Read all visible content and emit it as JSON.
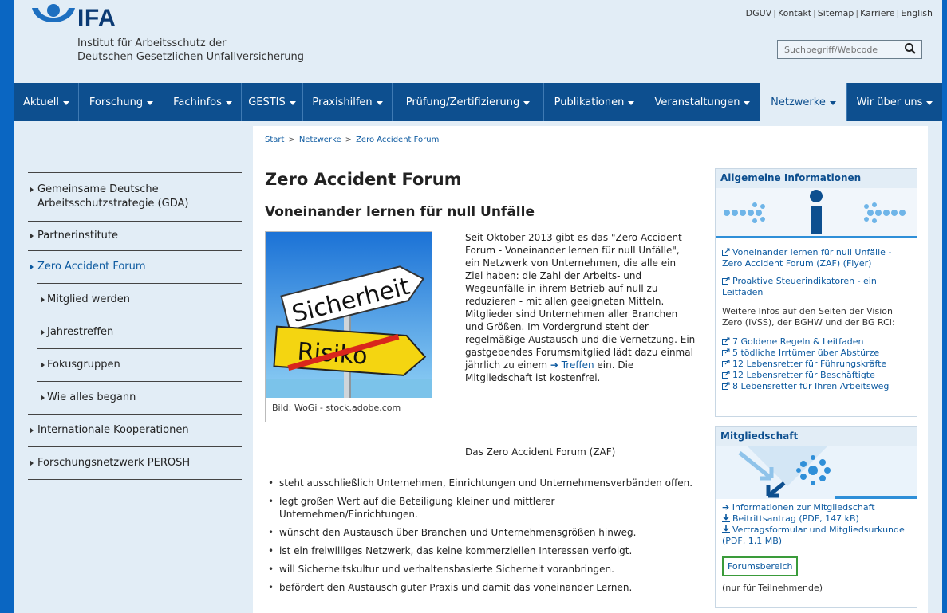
{
  "header": {
    "logo_text": "IFA",
    "logo_sub_line1": "Institut für Arbeitsschutz der",
    "logo_sub_line2": "Deutschen Gesetzlichen Unfallversicherung",
    "util_links": [
      "DGUV",
      "Kontakt",
      "Sitemap",
      "Karriere",
      "English"
    ],
    "search_placeholder": "Suchbegriff/Webcode"
  },
  "nav": {
    "items": [
      {
        "label": "Aktuell"
      },
      {
        "label": "Forschung"
      },
      {
        "label": "Fachinfos"
      },
      {
        "label": "GESTIS"
      },
      {
        "label": "Praxishilfen"
      },
      {
        "label": "Prüfung/Zertifizierung"
      },
      {
        "label": "Publikationen"
      },
      {
        "label": "Veranstaltungen"
      },
      {
        "label": "Netzwerke",
        "active": true
      },
      {
        "label": "Wir über uns"
      }
    ]
  },
  "breadcrumb": [
    "Start",
    "Netzwerke",
    "Zero Accident Forum"
  ],
  "sidebar": {
    "items": [
      {
        "label": "Gemeinsame Deutsche Arbeitsschutzstrategie (GDA)"
      },
      {
        "label": "Partnerinstitute"
      },
      {
        "label": "Zero Accident Forum"
      },
      {
        "label": "Mitglied werden"
      },
      {
        "label": "Jahrestreffen"
      },
      {
        "label": "Fokusgruppen"
      },
      {
        "label": "Wie alles begann"
      },
      {
        "label": "Internationale Kooperationen"
      },
      {
        "label": "Forschungsnetzwerk PEROSH"
      }
    ]
  },
  "main": {
    "title": "Zero Accident Forum",
    "subtitle": "Voneinander lernen für null Unfälle",
    "hero_sign_top": "Sicherheit",
    "hero_sign_bottom": "Risiko",
    "hero_caption": "Bild: WoGi - stock.adobe.com",
    "intro_before_link": "Seit Oktober 2013 gibt es das \"Zero Accident Forum - Voneinander lernen für null Unfälle\", ein Netzwerk von Unternehmen, die alle ein Ziel haben: die Zahl der Arbeits- und Wegeunfälle in ihrem Betrieb auf null zu reduzieren - mit allen geeigneten Mitteln. Mitglieder sind Unternehmen aller Branchen und Größen. Im Vordergrund steht der regelmäßige Austausch und die Vernetzung. Ein gastgebendes Forumsmitglied lädt dazu einmal jährlich zu einem ",
    "intro_link": "Treffen",
    "intro_after_link": " ein. Die Mitgliedschaft ist kostenfrei.",
    "zaf_lead": "Das Zero Accident Forum (ZAF)",
    "bullets": [
      "steht ausschließlich Unternehmen, Einrichtungen und Unternehmensverbänden offen.",
      "legt großen Wert auf die Beteiligung kleiner und mittlerer Unternehmen/Einrichtungen.",
      "wünscht den Austausch über Branchen und Unternehmensgrößen hinweg.",
      "ist ein freiwilliges Netzwerk, das keine kommerziellen Interessen verfolgt.",
      "will Sicherheitskultur und verhaltensbasierte Sicherheit voranbringen.",
      "befördert den Austausch guter Praxis und damit das voneinander Lernen."
    ]
  },
  "info_box": {
    "heading": "Allgemeine Informationen",
    "link1": "Voneinander lernen für null Unfälle - Zero Accident Forum (ZAF) (Flyer)",
    "link2": "Proaktive Steuerindikatoren - ein Leitfaden",
    "text": "Weitere Infos auf den Seiten der Vision Zero (IVSS), der BGHW und der BG RCI:",
    "links": [
      "7 Goldene Regeln & Leitfaden",
      "5 tödliche Irrtümer über Abstürze",
      "12 Lebensretter für Führungskräfte",
      "12 Lebensretter für Beschäftigte",
      "8 Lebensretter für Ihren Arbeitsweg"
    ]
  },
  "member_box": {
    "heading": "Mitgliedschaft",
    "link1": "Informationen zur Mitgliedschaft",
    "link2": "Beitrittsantrag (PDF, 147 kB)",
    "link3": "Vertragsformular und Mitgliedsurkunde (PDF, 1,1 MB)",
    "forum_button": "Forumsbereich",
    "forum_note": "(nur für Teilnehmende)"
  }
}
